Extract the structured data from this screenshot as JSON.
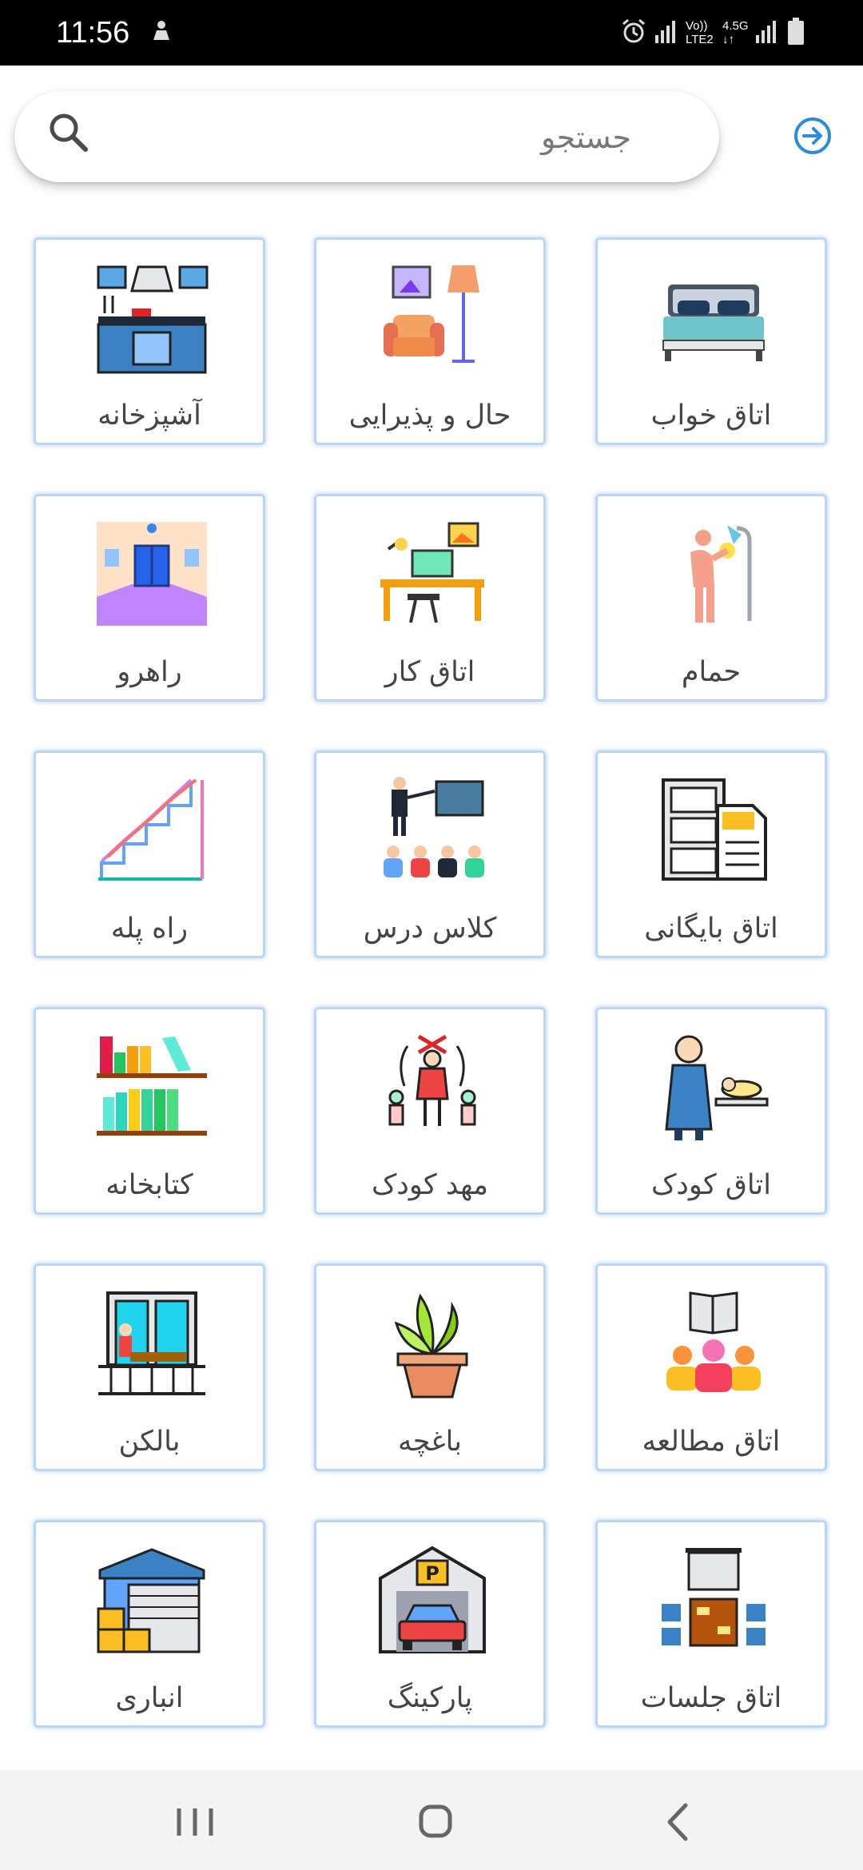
{
  "status_bar": {
    "time": "11:56",
    "net_top": "Vo))",
    "net_bottom": "LTE2",
    "speed_top": "4.5G",
    "speed_bottom": "↓↑"
  },
  "search": {
    "placeholder": "جستجو"
  },
  "tiles": [
    {
      "label": "اتاق خواب",
      "icon": "bed-icon"
    },
    {
      "label": "حال و پذیرایی",
      "icon": "living-room-icon"
    },
    {
      "label": "آشپزخانه",
      "icon": "kitchen-icon"
    },
    {
      "label": "حمام",
      "icon": "shower-icon"
    },
    {
      "label": "اتاق کار",
      "icon": "workspace-icon"
    },
    {
      "label": "راهرو",
      "icon": "hallway-icon"
    },
    {
      "label": "اتاق بایگانی",
      "icon": "archive-icon"
    },
    {
      "label": "کلاس درس",
      "icon": "classroom-icon"
    },
    {
      "label": "راه پله",
      "icon": "stairs-icon"
    },
    {
      "label": "اتاق کودک",
      "icon": "nursery-icon"
    },
    {
      "label": "مهد کودک",
      "icon": "kindergarten-icon"
    },
    {
      "label": "کتابخانه",
      "icon": "bookshelf-icon"
    },
    {
      "label": "اتاق مطالعه",
      "icon": "study-group-icon"
    },
    {
      "label": "باغچه",
      "icon": "plant-pot-icon"
    },
    {
      "label": "بالکن",
      "icon": "balcony-icon"
    },
    {
      "label": "اتاق جلسات",
      "icon": "meeting-room-icon"
    },
    {
      "label": "پارکینگ",
      "icon": "parking-garage-icon"
    },
    {
      "label": "انباری",
      "icon": "warehouse-icon"
    }
  ],
  "colors": {
    "accent": "#2a8cdc",
    "tile_border": "#b9d6f6",
    "label_text": "#444444"
  }
}
